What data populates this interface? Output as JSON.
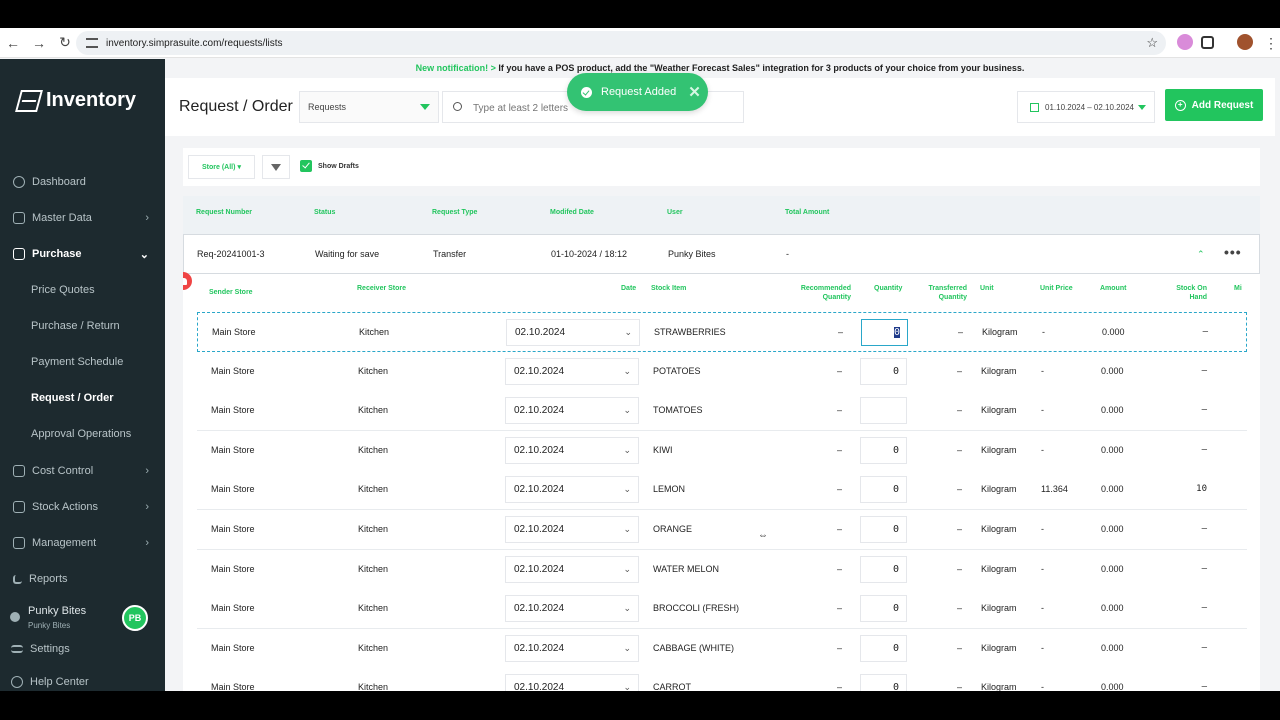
{
  "browser": {
    "url": "inventory.simprasuite.com/requests/lists"
  },
  "app": {
    "name": "Inventory"
  },
  "sidebar": {
    "items": [
      {
        "label": "Dashboard",
        "icon": "dashboard-icon",
        "has_chevron": false
      },
      {
        "label": "Master Data",
        "icon": "master-data-icon",
        "has_chevron": true
      },
      {
        "label": "Purchase",
        "icon": "purchase-icon",
        "has_chevron": true,
        "expanded": true
      },
      {
        "label": "Cost Control",
        "icon": "cost-control-icon",
        "has_chevron": true
      },
      {
        "label": "Stock Actions",
        "icon": "stock-actions-icon",
        "has_chevron": true
      },
      {
        "label": "Management",
        "icon": "management-icon",
        "has_chevron": true
      },
      {
        "label": "Reports",
        "icon": "reports-icon",
        "has_chevron": false
      }
    ],
    "purchase_sub": [
      "Price Quotes",
      "Purchase / Return",
      "Payment Schedule",
      "Request / Order",
      "Approval Operations"
    ],
    "active_sub": "Request / Order",
    "user": {
      "name": "Punky Bites",
      "sub": "Punky Bites",
      "initials": "PB"
    },
    "settings": "Settings",
    "help": "Help Center"
  },
  "notification": {
    "label": "New notification! >",
    "text": "If you have a POS product, add the \"Weather Forecast Sales\" integration for 3 products of your choice from your business."
  },
  "header": {
    "title": "Request / Order",
    "type_select": "Requests",
    "search_placeholder": "Type at least 2 letters",
    "date_range": "01.10.2024 – 02.10.2024",
    "add_button": "Add Request"
  },
  "toast": {
    "text": "Request Added"
  },
  "filters": {
    "store": "Store (All)",
    "show_drafts": "Show Drafts"
  },
  "table": {
    "headers": [
      "Request Number",
      "Status",
      "Request Type",
      "Modifed Date",
      "User",
      "Total Amount"
    ],
    "request": {
      "number": "Req-20241001-3",
      "status": "Waiting for save",
      "type": "Transfer",
      "modified": "01-10-2024 / 18:12",
      "user": "Punky Bites",
      "total": "-"
    }
  },
  "detail": {
    "headers": {
      "sender": "Sender Store",
      "receiver": "Receiver Store",
      "date": "Date",
      "stock_item": "Stock Item",
      "recommended": "Recommended Quantity",
      "quantity": "Quantity",
      "transferred": "Transferred Quantity",
      "unit": "Unit",
      "unit_price": "Unit Price",
      "amount": "Amount",
      "stock_on_hand": "Stock On Hand",
      "min": "Mi"
    },
    "rows": [
      {
        "sender": "Main Store",
        "receiver": "Kitchen",
        "date": "02.10.2024",
        "item": "STRAWBERRIES",
        "recommended": "–",
        "quantity": "0",
        "transferred": "–",
        "unit": "Kilogram",
        "unit_price": "-",
        "amount": "0.000",
        "stock": "–"
      },
      {
        "sender": "Main Store",
        "receiver": "Kitchen",
        "date": "02.10.2024",
        "item": "POTATOES",
        "recommended": "–",
        "quantity": "0",
        "transferred": "–",
        "unit": "Kilogram",
        "unit_price": "-",
        "amount": "0.000",
        "stock": "–"
      },
      {
        "sender": "Main Store",
        "receiver": "Kitchen",
        "date": "02.10.2024",
        "item": "TOMATOES",
        "recommended": "–",
        "quantity": "",
        "transferred": "–",
        "unit": "Kilogram",
        "unit_price": "-",
        "amount": "0.000",
        "stock": "–"
      },
      {
        "sender": "Main Store",
        "receiver": "Kitchen",
        "date": "02.10.2024",
        "item": "KIWI",
        "recommended": "–",
        "quantity": "0",
        "transferred": "–",
        "unit": "Kilogram",
        "unit_price": "-",
        "amount": "0.000",
        "stock": "–"
      },
      {
        "sender": "Main Store",
        "receiver": "Kitchen",
        "date": "02.10.2024",
        "item": "LEMON",
        "recommended": "–",
        "quantity": "0",
        "transferred": "–",
        "unit": "Kilogram",
        "unit_price": "11.364",
        "amount": "0.000",
        "stock": "10"
      },
      {
        "sender": "Main Store",
        "receiver": "Kitchen",
        "date": "02.10.2024",
        "item": "ORANGE",
        "recommended": "–",
        "quantity": "0",
        "transferred": "–",
        "unit": "Kilogram",
        "unit_price": "-",
        "amount": "0.000",
        "stock": "–"
      },
      {
        "sender": "Main Store",
        "receiver": "Kitchen",
        "date": "02.10.2024",
        "item": "WATER MELON",
        "recommended": "–",
        "quantity": "0",
        "transferred": "–",
        "unit": "Kilogram",
        "unit_price": "-",
        "amount": "0.000",
        "stock": "–"
      },
      {
        "sender": "Main Store",
        "receiver": "Kitchen",
        "date": "02.10.2024",
        "item": "BROCCOLI (FRESH)",
        "recommended": "–",
        "quantity": "0",
        "transferred": "–",
        "unit": "Kilogram",
        "unit_price": "-",
        "amount": "0.000",
        "stock": "–"
      },
      {
        "sender": "Main Store",
        "receiver": "Kitchen",
        "date": "02.10.2024",
        "item": "CABBAGE (WHITE)",
        "recommended": "–",
        "quantity": "0",
        "transferred": "–",
        "unit": "Kilogram",
        "unit_price": "-",
        "amount": "0.000",
        "stock": "–"
      },
      {
        "sender": "Main Store",
        "receiver": "Kitchen",
        "date": "02.10.2024",
        "item": "CARROT",
        "recommended": "–",
        "quantity": "0",
        "transferred": "–",
        "unit": "Kilogram",
        "unit_price": "-",
        "amount": "0.000",
        "stock": "–"
      }
    ]
  },
  "colors": {
    "accent": "#22c55e",
    "sidebar_bg": "#1d2a2f",
    "alert": "#ef4444",
    "selection": "#2aa7c9"
  }
}
